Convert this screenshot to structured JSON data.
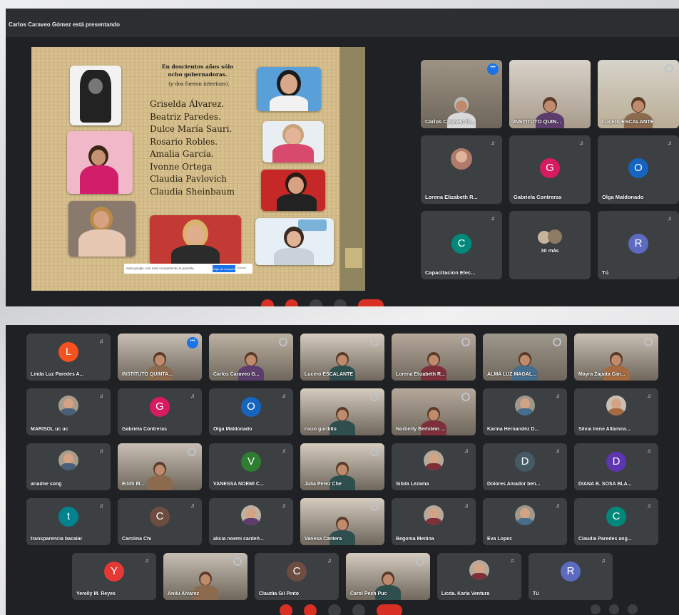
{
  "top_meeting": {
    "presenting_banner": "Carlos Caraveo Gómez está presentando",
    "slide": {
      "title_line1": "En doscientos años sólo",
      "title_line2": "ocho gobernadoras.",
      "subtitle": "(y dos fueron interinas).",
      "governors": [
        "Griselda Álvarez.",
        "Beatriz Paredes.",
        "Dulce María Sauri.",
        "Rosario Robles.",
        "Amalia García.",
        "Ivonne Ortega",
        "Claudia Pavlovich",
        "Claudia Sheinbaum"
      ]
    },
    "share_bar": {
      "notice": "meet.google.com está compartiendo la pantalla.",
      "stop_button": "Dejar de compartir",
      "hide_button": "Ocultar"
    },
    "participants": [
      {
        "name": "Carlos Caraveo G...",
        "type": "video",
        "active": true
      },
      {
        "name": "INSTITUTO QUIN...",
        "type": "video"
      },
      {
        "name": "Lucero ESCALANTE",
        "type": "video"
      },
      {
        "name": "Lorena Elizabeth R...",
        "type": "photo"
      },
      {
        "name": "Gabriela Contreras",
        "type": "avatar",
        "letter": "G",
        "color": "#d81b60"
      },
      {
        "name": "Olga Maldonado",
        "type": "avatar",
        "letter": "O",
        "color": "#1565c0"
      },
      {
        "name": "Capacitacion Elec...",
        "type": "avatar",
        "letter": "C",
        "color": "#00897b"
      },
      {
        "name": "30 más",
        "type": "more"
      },
      {
        "name": "Tú",
        "type": "avatar",
        "letter": "R",
        "color": "#5c6bc0"
      }
    ]
  },
  "bottom_meeting": {
    "participants": [
      {
        "name": "Linda Luz Paredes A...",
        "type": "avatar",
        "letter": "L",
        "color": "#f4511e"
      },
      {
        "name": "INSTITUTO QUINTA...",
        "type": "video",
        "active": true
      },
      {
        "name": "Carlos Caraveo G...",
        "type": "video"
      },
      {
        "name": "Lucero ESCALANTE",
        "type": "video"
      },
      {
        "name": "Lorena Elizabeth R...",
        "type": "video"
      },
      {
        "name": "ALMA LUZ MAGAL...",
        "type": "video"
      },
      {
        "name": "Mayra Zapata Can...",
        "type": "video"
      },
      {
        "name": "MARISOL uc uc",
        "type": "photo"
      },
      {
        "name": "Gabriela Contreras",
        "type": "avatar",
        "letter": "G",
        "color": "#d81b60"
      },
      {
        "name": "Olga Maldonado",
        "type": "avatar",
        "letter": "O",
        "color": "#1565c0"
      },
      {
        "name": "rocio gordillo",
        "type": "video"
      },
      {
        "name": "Norberty Berlstein ...",
        "type": "video"
      },
      {
        "name": "Karina Hernandez D...",
        "type": "photo"
      },
      {
        "name": "Silvia Irene Altamira...",
        "type": "photo"
      },
      {
        "name": "ariadne song",
        "type": "photo"
      },
      {
        "name": "Edith M...",
        "type": "video"
      },
      {
        "name": "VANESSA NOEMI C...",
        "type": "avatar",
        "letter": "V",
        "color": "#2e7d32"
      },
      {
        "name": "Julia Perez Che",
        "type": "video"
      },
      {
        "name": "Sibila Lezama",
        "type": "photo"
      },
      {
        "name": "Dolores Amador ben...",
        "type": "avatar",
        "letter": "D",
        "color": "#455a64"
      },
      {
        "name": "DIANA B. SOSA BLA...",
        "type": "avatar",
        "letter": "D",
        "color": "#5e35b1"
      },
      {
        "name": "transparencia bacalar",
        "type": "avatar",
        "letter": "t",
        "color": "#00838f"
      },
      {
        "name": "Carolina Chi",
        "type": "avatar",
        "letter": "C",
        "color": "#6d4c41"
      },
      {
        "name": "alicia noemi cardeñ...",
        "type": "photo"
      },
      {
        "name": "Vanesa Cantera",
        "type": "video"
      },
      {
        "name": "Begonia Medina",
        "type": "photo"
      },
      {
        "name": "Eva Lopez",
        "type": "photo"
      },
      {
        "name": "Claudia Paredes ang...",
        "type": "avatar",
        "letter": "C",
        "color": "#00897b"
      },
      {
        "name": "Yerelly M. Reyes",
        "type": "avatar",
        "letter": "Y",
        "color": "#e53935"
      },
      {
        "name": "Anilu Alvarez",
        "type": "video"
      },
      {
        "name": "Claudia Gil Pinto",
        "type": "avatar",
        "letter": "C",
        "color": "#6d4c41"
      },
      {
        "name": "Carol Pech Puc",
        "type": "video"
      },
      {
        "name": "Licda. Karla Ventura",
        "type": "photo"
      },
      {
        "name": "Tú",
        "type": "avatar",
        "letter": "R",
        "color": "#5c6bc0"
      }
    ]
  }
}
